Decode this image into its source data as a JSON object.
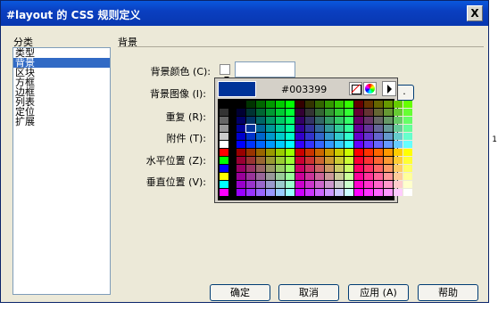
{
  "window": {
    "title": "#layout 的 CSS 规则定义",
    "close_label": "X"
  },
  "categories": {
    "label": "分类",
    "items": [
      "类型",
      "背景",
      "区块",
      "方框",
      "边框",
      "列表",
      "定位",
      "扩展"
    ],
    "selected_index": 1
  },
  "section": {
    "title": "背景"
  },
  "fields": {
    "bg_color_label": "背景颜色 (C):",
    "bg_image_label": "背景图像 (I):",
    "repeat_label": "重复 (R):",
    "attachment_label": "附件 (T):",
    "h_position_label": "水平位置 (Z):",
    "v_position_label": "垂直位置 (V):",
    "bg_color_value": "",
    "browse_label": "."
  },
  "color_picker": {
    "hex": "#003399",
    "preview_color": "#003399",
    "nocolor_icon": "no-color-icon",
    "wheel_icon": "color-wheel-icon",
    "menu_icon": "menu-arrow-icon"
  },
  "buttons": {
    "ok": "确定",
    "cancel": "取消",
    "apply": "应用 (A)",
    "help": "帮助"
  },
  "edge_fragment": "1"
}
